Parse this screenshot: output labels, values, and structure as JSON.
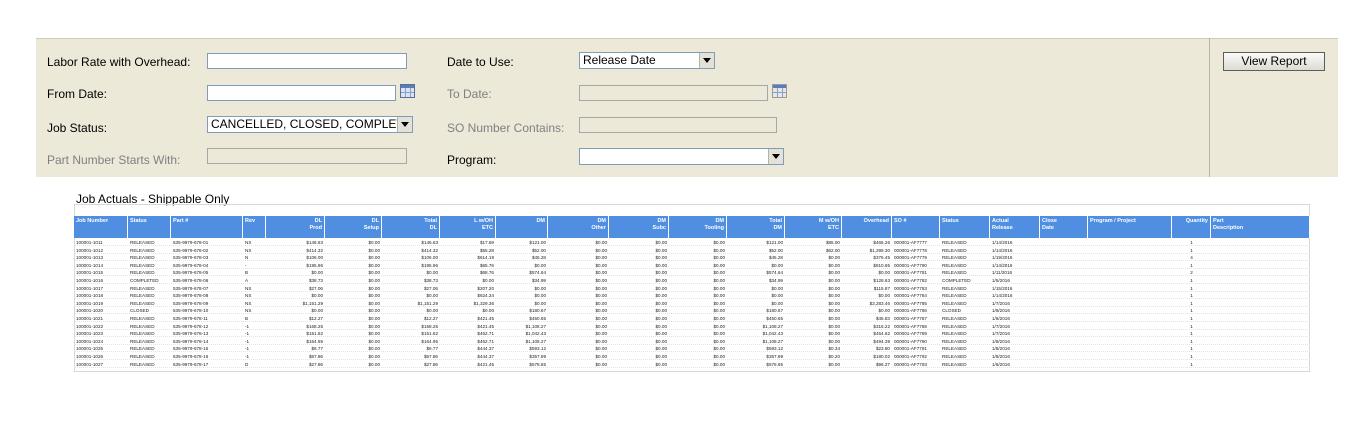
{
  "filters": {
    "labor_rate_label": "Labor Rate with Overhead:",
    "labor_rate_value": "",
    "date_to_use_label": "Date to Use:",
    "date_to_use_value": "Release Date",
    "from_date_label": "From Date:",
    "from_date_value": "",
    "to_date_label": "To Date:",
    "to_date_value": "",
    "job_status_label": "Job Status:",
    "job_status_value": "CANCELLED, CLOSED, COMPLETED,",
    "so_number_label": "SO Number Contains:",
    "so_number_value": "",
    "part_number_label": "Part Number Starts With:",
    "part_number_value": "",
    "program_label": "Program:",
    "program_value": ""
  },
  "view_report_label": "View Report",
  "report": {
    "title": "Job Actuals - Shippable Only",
    "columns": [
      {
        "l1": "Job Number",
        "l2": "",
        "align": "l"
      },
      {
        "l1": "Status",
        "l2": "",
        "align": "l"
      },
      {
        "l1": "Part #",
        "l2": "",
        "align": "l"
      },
      {
        "l1": "Rev",
        "l2": "",
        "align": "l"
      },
      {
        "l1": "DL",
        "l2": "Prod",
        "align": "r"
      },
      {
        "l1": "DL",
        "l2": "Setup",
        "align": "r"
      },
      {
        "l1": "Total",
        "l2": "DL",
        "align": "r"
      },
      {
        "l1": "L w/OH",
        "l2": "ETC",
        "align": "r"
      },
      {
        "l1": "DM",
        "l2": "",
        "align": "r"
      },
      {
        "l1": "DM",
        "l2": "Other",
        "align": "r"
      },
      {
        "l1": "DM",
        "l2": "Subc",
        "align": "r"
      },
      {
        "l1": "DM",
        "l2": "Tooling",
        "align": "r"
      },
      {
        "l1": "Total",
        "l2": "DM",
        "align": "r"
      },
      {
        "l1": "M w/OH",
        "l2": "ETC",
        "align": "r"
      },
      {
        "l1": "Overhead",
        "l2": "",
        "align": "r"
      },
      {
        "l1": "SO #",
        "l2": "",
        "align": "l"
      },
      {
        "l1": "Status",
        "l2": "",
        "align": "l"
      },
      {
        "l1": "Actual",
        "l2": "Release",
        "align": "l"
      },
      {
        "l1": "Close",
        "l2": "Date",
        "align": "l"
      },
      {
        "l1": "Program / Project",
        "l2": "",
        "align": "l"
      },
      {
        "l1": "Quantity",
        "l2": "",
        "align": "r"
      },
      {
        "l1": "Part",
        "l2": "Description",
        "align": "l"
      }
    ],
    "rows": [
      [
        "100001-1011",
        "RELEASED",
        "535-9979-678-01",
        "NS",
        "$146.63",
        "$0.00",
        "$146.63",
        "$17.69",
        "$121.00",
        "$0.00",
        "$0.00",
        "$0.00",
        "$121.00",
        "$85.00",
        "$466.26",
        "000001-AF7777",
        "RELEASED",
        "1/14/2016",
        "",
        "",
        "1",
        ""
      ],
      [
        "100001-1012",
        "RELEASED",
        "535-9979-678-02",
        "NS",
        "$414.32",
        "$0.00",
        "$414.32",
        "$55.28",
        "$52.00",
        "$0.00",
        "$0.00",
        "$0.00",
        "$52.00",
        "$62.00",
        "$1,299.30",
        "000001-AF7778",
        "RELEASED",
        "1/14/2016",
        "",
        "",
        "1",
        ""
      ],
      [
        "100001-1013",
        "RELEASED",
        "535-9979-678-03",
        "N",
        "$106.00",
        "$0.00",
        "$106.00",
        "$614.19",
        "$45.28",
        "$0.00",
        "$0.00",
        "$0.00",
        "$45.28",
        "$0.00",
        "$376.45",
        "000001-AF7779",
        "RELEASED",
        "1/19/2016",
        "",
        "",
        "4",
        ""
      ],
      [
        "100001-1014",
        "RELEASED",
        "535-9979-678-04",
        "-",
        "$195.96",
        "$0.00",
        "$195.96",
        "$65.76",
        "$0.00",
        "$0.00",
        "$0.00",
        "$0.00",
        "$0.00",
        "$0.00",
        "$810.65",
        "000001-AF7780",
        "RELEASED",
        "1/14/2016",
        "",
        "",
        "1",
        ""
      ],
      [
        "100001-1015",
        "RELEASED",
        "535-9979-678-05",
        "B",
        "$0.00",
        "$0.00",
        "$0.00",
        "$68.76",
        "$574.64",
        "$0.00",
        "$0.00",
        "$0.00",
        "$574.64",
        "$0.00",
        "$0.00",
        "000001-AF7781",
        "RELEASED",
        "1/11/2016",
        "",
        "",
        "2",
        ""
      ],
      [
        "100001-1016",
        "COMPLETED",
        "535-9979-678-06",
        "A",
        "$38.73",
        "$0.00",
        "$38.73",
        "$0.00",
        "$34.99",
        "$0.00",
        "$0.00",
        "$0.00",
        "$34.99",
        "$0.00",
        "$128.63",
        "000001-AF7782",
        "COMPLETED",
        "1/5/2016",
        "",
        "",
        "1",
        ""
      ],
      [
        "100001-1017",
        "RELEASED",
        "535-9979-678-07",
        "NS",
        "$27.06",
        "$0.00",
        "$27.06",
        "$207.20",
        "$0.00",
        "$0.00",
        "$0.00",
        "$0.00",
        "$0.00",
        "$0.00",
        "$115.87",
        "000001-AF7783",
        "RELEASED",
        "1/15/2016",
        "",
        "",
        "1",
        ""
      ],
      [
        "100001-1018",
        "RELEASED",
        "535-9979-678-08",
        "NS",
        "$0.00",
        "$0.00",
        "$0.00",
        "$624.34",
        "$0.00",
        "$0.00",
        "$0.00",
        "$0.00",
        "$0.00",
        "$0.00",
        "$0.00",
        "000001-AF7784",
        "RELEASED",
        "1/14/2016",
        "",
        "",
        "1",
        ""
      ],
      [
        "100001-1019",
        "RELEASED",
        "535-9979-678-09",
        "NS",
        "$1,151.29",
        "$0.00",
        "$1,151.29",
        "$1,329.36",
        "$0.00",
        "$0.00",
        "$0.00",
        "$0.00",
        "$0.00",
        "$0.00",
        "$3,283.46",
        "000001-AF7785",
        "RELEASED",
        "1/7/2016",
        "",
        "",
        "1",
        ""
      ],
      [
        "100001-1020",
        "CLOSED",
        "535-9979-678-10",
        "NS",
        "$0.00",
        "$0.00",
        "$0.00",
        "$0.00",
        "$180.67",
        "$0.00",
        "$0.00",
        "$0.00",
        "$180.67",
        "$0.00",
        "$0.00",
        "000001-AF7786",
        "CLOSED",
        "1/8/2016",
        "",
        "",
        "1",
        ""
      ],
      [
        "100001-1021",
        "RELEASED",
        "535-9979-678-11",
        "B",
        "$12.27",
        "$0.00",
        "$12.27",
        "$421.45",
        "$450.65",
        "$0.00",
        "$0.00",
        "$0.00",
        "$450.65",
        "$0.00",
        "$45.83",
        "000001-AF7787",
        "RELEASED",
        "1/6/2016",
        "",
        "",
        "1",
        ""
      ],
      [
        "100001-1022",
        "RELEASED",
        "535-9979-678-12",
        "-1",
        "$168.25",
        "$0.00",
        "$168.25",
        "$421.45",
        "$1,108.27",
        "$0.00",
        "$0.00",
        "$0.00",
        "$1,108.27",
        "$0.00",
        "$316.22",
        "000001-AF7788",
        "RELEASED",
        "1/7/2016",
        "",
        "",
        "1",
        ""
      ],
      [
        "100001-1023",
        "RELEASED",
        "535-9979-678-13",
        "-1",
        "$151.62",
        "$0.00",
        "$151.62",
        "$462.71",
        "$1,042.43",
        "$0.00",
        "$0.00",
        "$0.00",
        "$1,042.43",
        "$0.00",
        "$454.62",
        "000001-AF7789",
        "RELEASED",
        "1/7/2016",
        "",
        "",
        "1",
        ""
      ],
      [
        "100001-1024",
        "RELEASED",
        "535-9979-678-14",
        "-1",
        "$164.95",
        "$0.00",
        "$164.95",
        "$462.71",
        "$1,108.27",
        "$0.00",
        "$0.00",
        "$0.00",
        "$1,108.27",
        "$0.00",
        "$494.39",
        "000001-AF7790",
        "RELEASED",
        "1/8/2016",
        "",
        "",
        "1",
        ""
      ],
      [
        "100001-1025",
        "RELEASED",
        "535-9979-678-15",
        "-1",
        "$6.77",
        "$0.00",
        "$6.77",
        "$444.37",
        "$593.12",
        "$0.00",
        "$0.00",
        "$0.00",
        "$593.12",
        "$0.34",
        "$23.80",
        "000001-AF7791",
        "RELEASED",
        "1/8/2016",
        "",
        "",
        "1",
        ""
      ],
      [
        "100001-1026",
        "RELEASED",
        "535-9979-678-16",
        "-1",
        "$57.86",
        "$0.00",
        "$57.86",
        "$444.37",
        "$357.99",
        "$0.00",
        "$0.00",
        "$0.00",
        "$357.99",
        "$0.20",
        "$180.02",
        "000001-AF7792",
        "RELEASED",
        "1/8/2016",
        "",
        "",
        "1",
        ""
      ],
      [
        "100001-1027",
        "RELEASED",
        "535-9979-678-17",
        "D",
        "$27.86",
        "$0.00",
        "$27.86",
        "$421.45",
        "$578.65",
        "$0.00",
        "$0.00",
        "$0.00",
        "$578.65",
        "$0.00",
        "$96.27",
        "000001-AF7793",
        "RELEASED",
        "1/6/2016",
        "",
        "",
        "1",
        ""
      ]
    ]
  },
  "colors": {
    "panel_bg": "#ece9d8",
    "header_bg": "#4f8ee0",
    "disabled_label": "#808080"
  }
}
